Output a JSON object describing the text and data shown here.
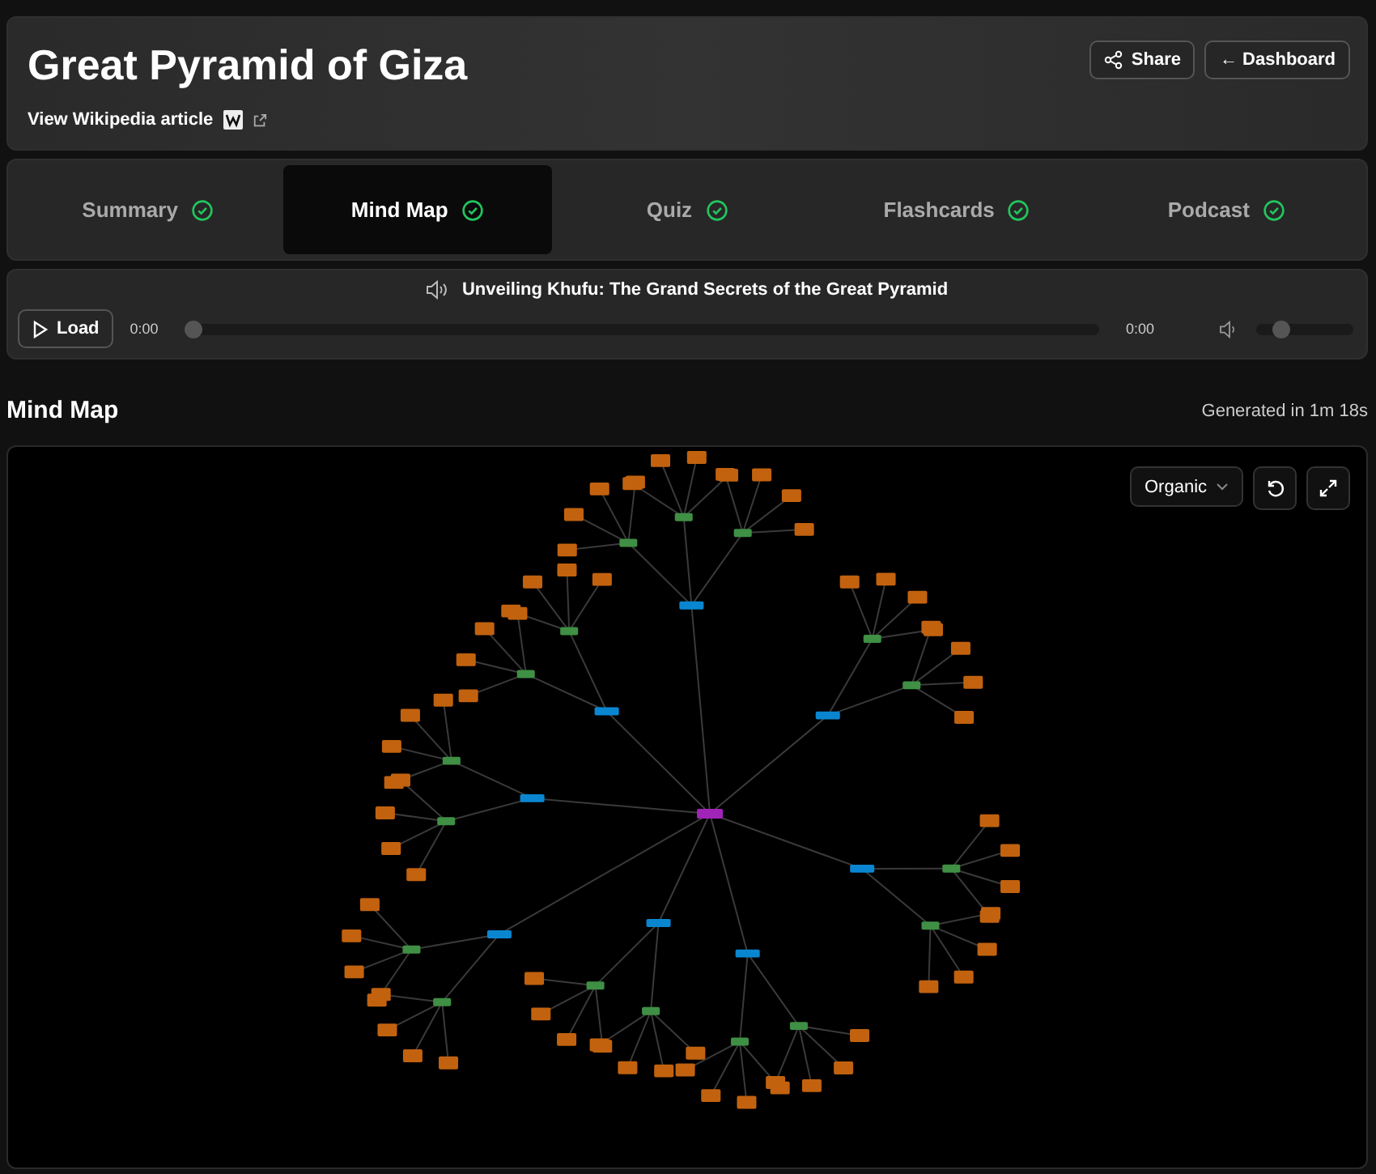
{
  "header": {
    "title": "Great Pyramid of Giza",
    "wiki_link": "View Wikipedia article",
    "buttons": [
      {
        "label": "Share",
        "kind": "share"
      },
      {
        "label": "← Dashboard",
        "kind": "plain"
      }
    ]
  },
  "tabs": [
    {
      "label": "Summary",
      "selected": false,
      "complete": true
    },
    {
      "label": "Mind Map",
      "selected": true,
      "complete": true
    },
    {
      "label": "Quiz",
      "selected": false,
      "complete": true
    },
    {
      "label": "Flashcards",
      "selected": false,
      "complete": true
    },
    {
      "label": "Podcast",
      "selected": false,
      "complete": true
    }
  ],
  "player": {
    "title": "Unveiling Khufu: The Grand Secrets of the Great Pyramid",
    "load_button": "Load",
    "elapsed": "0:00",
    "level": 0,
    "duration": "0:00",
    "volume": {
      "level": 0.25
    }
  },
  "section": {
    "title": "Mind Map",
    "generated": "Generated in 1m 18s"
  },
  "mind_map": {
    "layout_select": {
      "value": "Organic"
    }
  }
}
